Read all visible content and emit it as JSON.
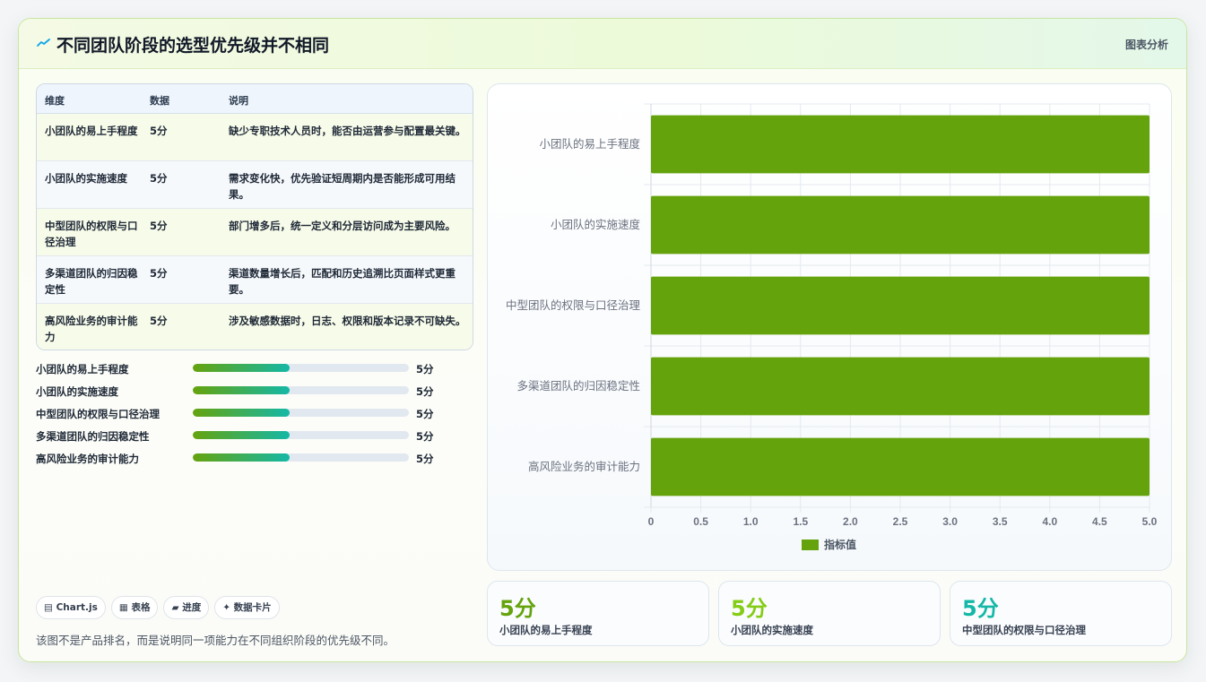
{
  "header": {
    "title": "不同团队阶段的选型优先级并不相同",
    "tag": "图表分析",
    "icon": "trend-icon"
  },
  "table": {
    "headers": [
      "维度",
      "数据",
      "说明"
    ],
    "rows": [
      {
        "dim": "小团队的易上手程度",
        "value": "5分",
        "desc": "缺少专职技术人员时，能否由运营参与配置最关键。"
      },
      {
        "dim": "小团队的实施速度",
        "value": "5分",
        "desc": "需求变化快，优先验证短周期内是否能形成可用结果。"
      },
      {
        "dim": "中型团队的权限与口径治理",
        "value": "5分",
        "desc": "部门增多后，统一定义和分层访问成为主要风险。"
      },
      {
        "dim": "多渠道团队的归因稳定性",
        "value": "5分",
        "desc": "渠道数量增长后，匹配和历史追溯比页面样式更重要。"
      },
      {
        "dim": "高风险业务的审计能力",
        "value": "5分",
        "desc": "涉及敏感数据时，日志、权限和版本记录不可缺失。"
      }
    ]
  },
  "progress": [
    {
      "label": "小团队的易上手程度",
      "value": "5分",
      "fraction": 0.45
    },
    {
      "label": "小团队的实施速度",
      "value": "5分",
      "fraction": 0.45
    },
    {
      "label": "中型团队的权限与口径治理",
      "value": "5分",
      "fraction": 0.45
    },
    {
      "label": "多渠道团队的归因稳定性",
      "value": "5分",
      "fraction": 0.45
    },
    {
      "label": "高风险业务的审计能力",
      "value": "5分",
      "fraction": 0.45
    }
  ],
  "chips": [
    "▤ Chart.js",
    "▦ 表格",
    "▰ 进度",
    "✦ 数据卡片"
  ],
  "note": "该图不是产品排名，而是说明同一项能力在不同组织阶段的优先级不同。",
  "kpis": [
    {
      "value": "5分",
      "label": "小团队的易上手程度",
      "color": "#65a30d"
    },
    {
      "value": "5分",
      "label": "小团队的实施速度",
      "color": "#84cc16"
    },
    {
      "value": "5分",
      "label": "中型团队的权限与口径治理",
      "color": "#14b8a6"
    }
  ],
  "colors": {
    "bar": "#65a30d",
    "accent": "#84cc16",
    "teal": "#14b8a6"
  },
  "chart_data": {
    "type": "bar",
    "orientation": "horizontal",
    "categories": [
      "小团队的易上手程度",
      "小团队的实施速度",
      "中型团队的权限与口径治理",
      "多渠道团队的归因稳定性",
      "高风险业务的审计能力"
    ],
    "series": [
      {
        "name": "指标值",
        "values": [
          5,
          5,
          5,
          5,
          5
        ]
      }
    ],
    "xlim": [
      0,
      5
    ],
    "x_ticks": [
      "0",
      "0.5",
      "1.0",
      "1.5",
      "2.0",
      "2.5",
      "3.0",
      "3.5",
      "4.0",
      "4.5",
      "5.0"
    ],
    "grid": true,
    "legend": "bottom"
  }
}
